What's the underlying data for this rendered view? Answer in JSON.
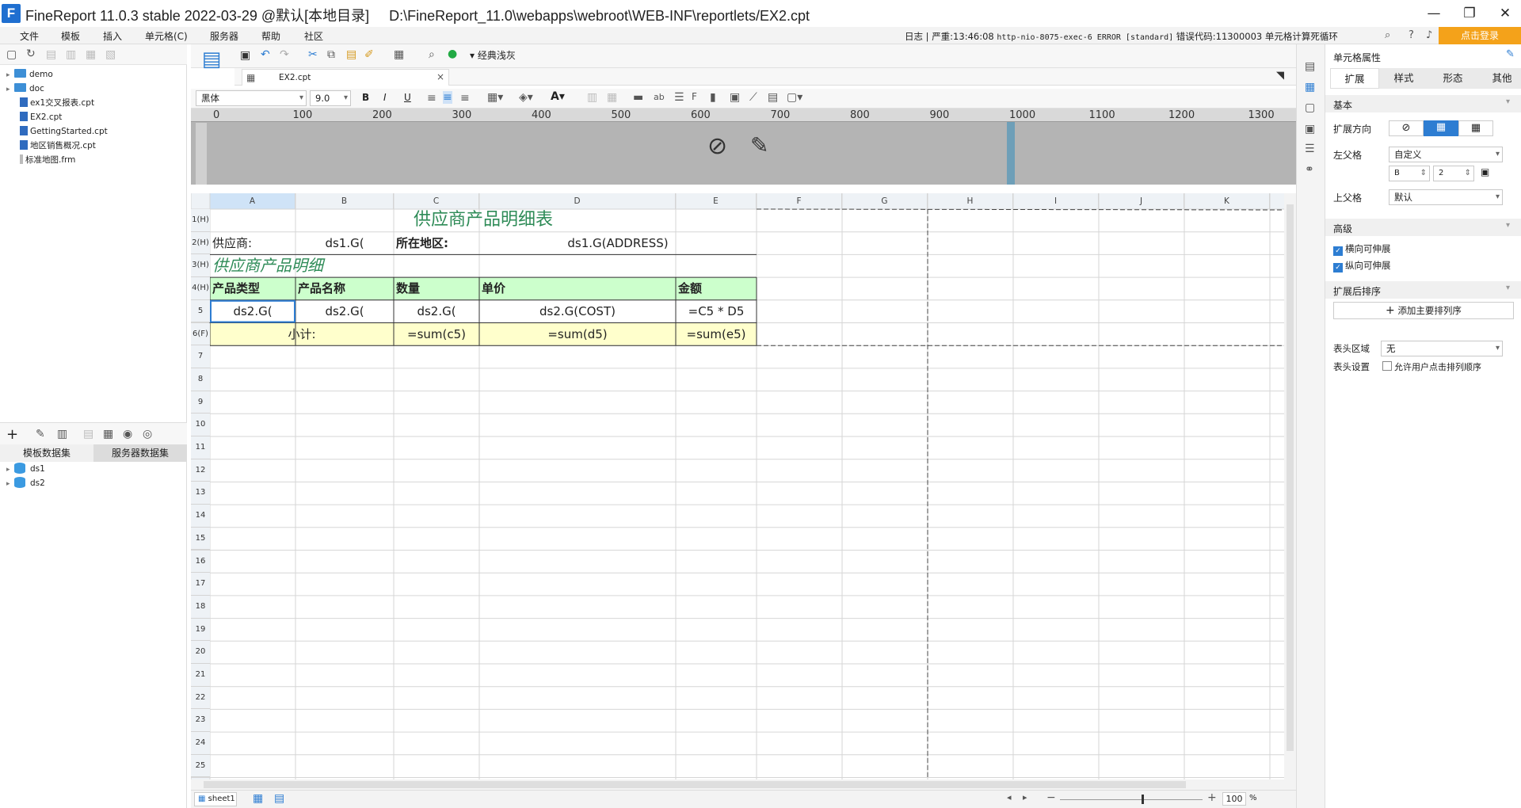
{
  "window": {
    "title": "FineReport 11.0.3 stable 2022-03-29 @默认[本地目录]     D:\\FineReport_11.0\\webapps\\webroot\\WEB-INF\\reportlets/EX2.cpt",
    "logo_letter": "F"
  },
  "menu": [
    "文件",
    "模板",
    "插入",
    "单元格(C)",
    "服务器",
    "帮助",
    "社区"
  ],
  "status": {
    "log": "日志",
    "severity": "严重:13:46:08",
    "detail": "http-nio-8075-exec-6 ERROR [standard]",
    "message": "错误代码:11300003 单元格计算死循环",
    "login": "点击登录"
  },
  "file_tree": [
    {
      "name": "demo",
      "type": "folder"
    },
    {
      "name": "doc",
      "type": "folder"
    },
    {
      "name": "ex1交叉报表.cpt",
      "type": "file"
    },
    {
      "name": "EX2.cpt",
      "type": "file"
    },
    {
      "name": "GettingStarted.cpt",
      "type": "file"
    },
    {
      "name": "地区销售概况.cpt",
      "type": "file"
    },
    {
      "name": "标准地图.frm",
      "type": "file"
    }
  ],
  "dataset_tabs": [
    "模板数据集",
    "服务器数据集"
  ],
  "datasets": [
    "ds1",
    "ds2"
  ],
  "doc_tab": {
    "name": "EX2.cpt",
    "toolbar_theme": "经典浅灰"
  },
  "format": {
    "font": "黑体",
    "size": "9.0"
  },
  "ruler_ticks": [
    "0",
    "100",
    "200",
    "300",
    "400",
    "500",
    "600",
    "700",
    "800",
    "900",
    "1000",
    "1100",
    "1200",
    "1300"
  ],
  "columns": [
    "A",
    "B",
    "C",
    "D",
    "E",
    "F",
    "G",
    "H",
    "I",
    "J",
    "K"
  ],
  "rows": [
    "1(H)",
    "2(H)",
    "3(H)",
    "4(H)",
    "5",
    "6(F)",
    "7",
    "8",
    "9",
    "10",
    "11",
    "12",
    "13",
    "14",
    "15",
    "16",
    "17",
    "18",
    "19",
    "20",
    "21",
    "22",
    "23",
    "24",
    "25"
  ],
  "cells": {
    "title": "供应商产品明细表",
    "supplier_label": "供应商:",
    "supplier_val": "ds1.G(",
    "region_label": "所在地区:",
    "region_val": "ds1.G(ADDRESS)",
    "subtitle": "供应商产品明细",
    "h_type": "产品类型",
    "h_name": "产品名称",
    "h_qty": "数量",
    "h_price": "单价",
    "h_amount": "金额",
    "r5_a": "ds2.G(",
    "r5_b": "ds2.G(",
    "r5_c": "ds2.G(",
    "r5_d": "ds2.G(COST)",
    "r5_e": "=C5 * D5",
    "subtotal": "小计:",
    "sum_c": "=sum(c5)",
    "sum_d": "=sum(d5)",
    "sum_e": "=sum(e5)"
  },
  "sheet": {
    "name": "sheet1",
    "zoom": "100",
    "zoom_unit": "%"
  },
  "props": {
    "title": "单元格属性",
    "tabs": [
      "扩展",
      "样式",
      "形态",
      "其他"
    ],
    "basic": "基本",
    "expand_dir": "扩展方向",
    "left_parent": "左父格",
    "left_parent_val": "自定义",
    "left_col": "B",
    "left_row": "2",
    "up_parent": "上父格",
    "up_parent_val": "默认",
    "advanced": "高级",
    "h_expand": "横向可伸展",
    "v_expand": "纵向可伸展",
    "sort_title": "扩展后排序",
    "add_sort": "添加主要排列序",
    "header_area": "表头区域",
    "header_area_val": "无",
    "header_setting": "表头设置",
    "allow_sort": "允许用户点击排列顺序"
  },
  "colors": {
    "accent": "#2d7dd2",
    "login": "#f4a21a",
    "header_fill": "#ccffcc",
    "footer_fill": "#ffffcc",
    "title_text": "#2e8b57"
  }
}
